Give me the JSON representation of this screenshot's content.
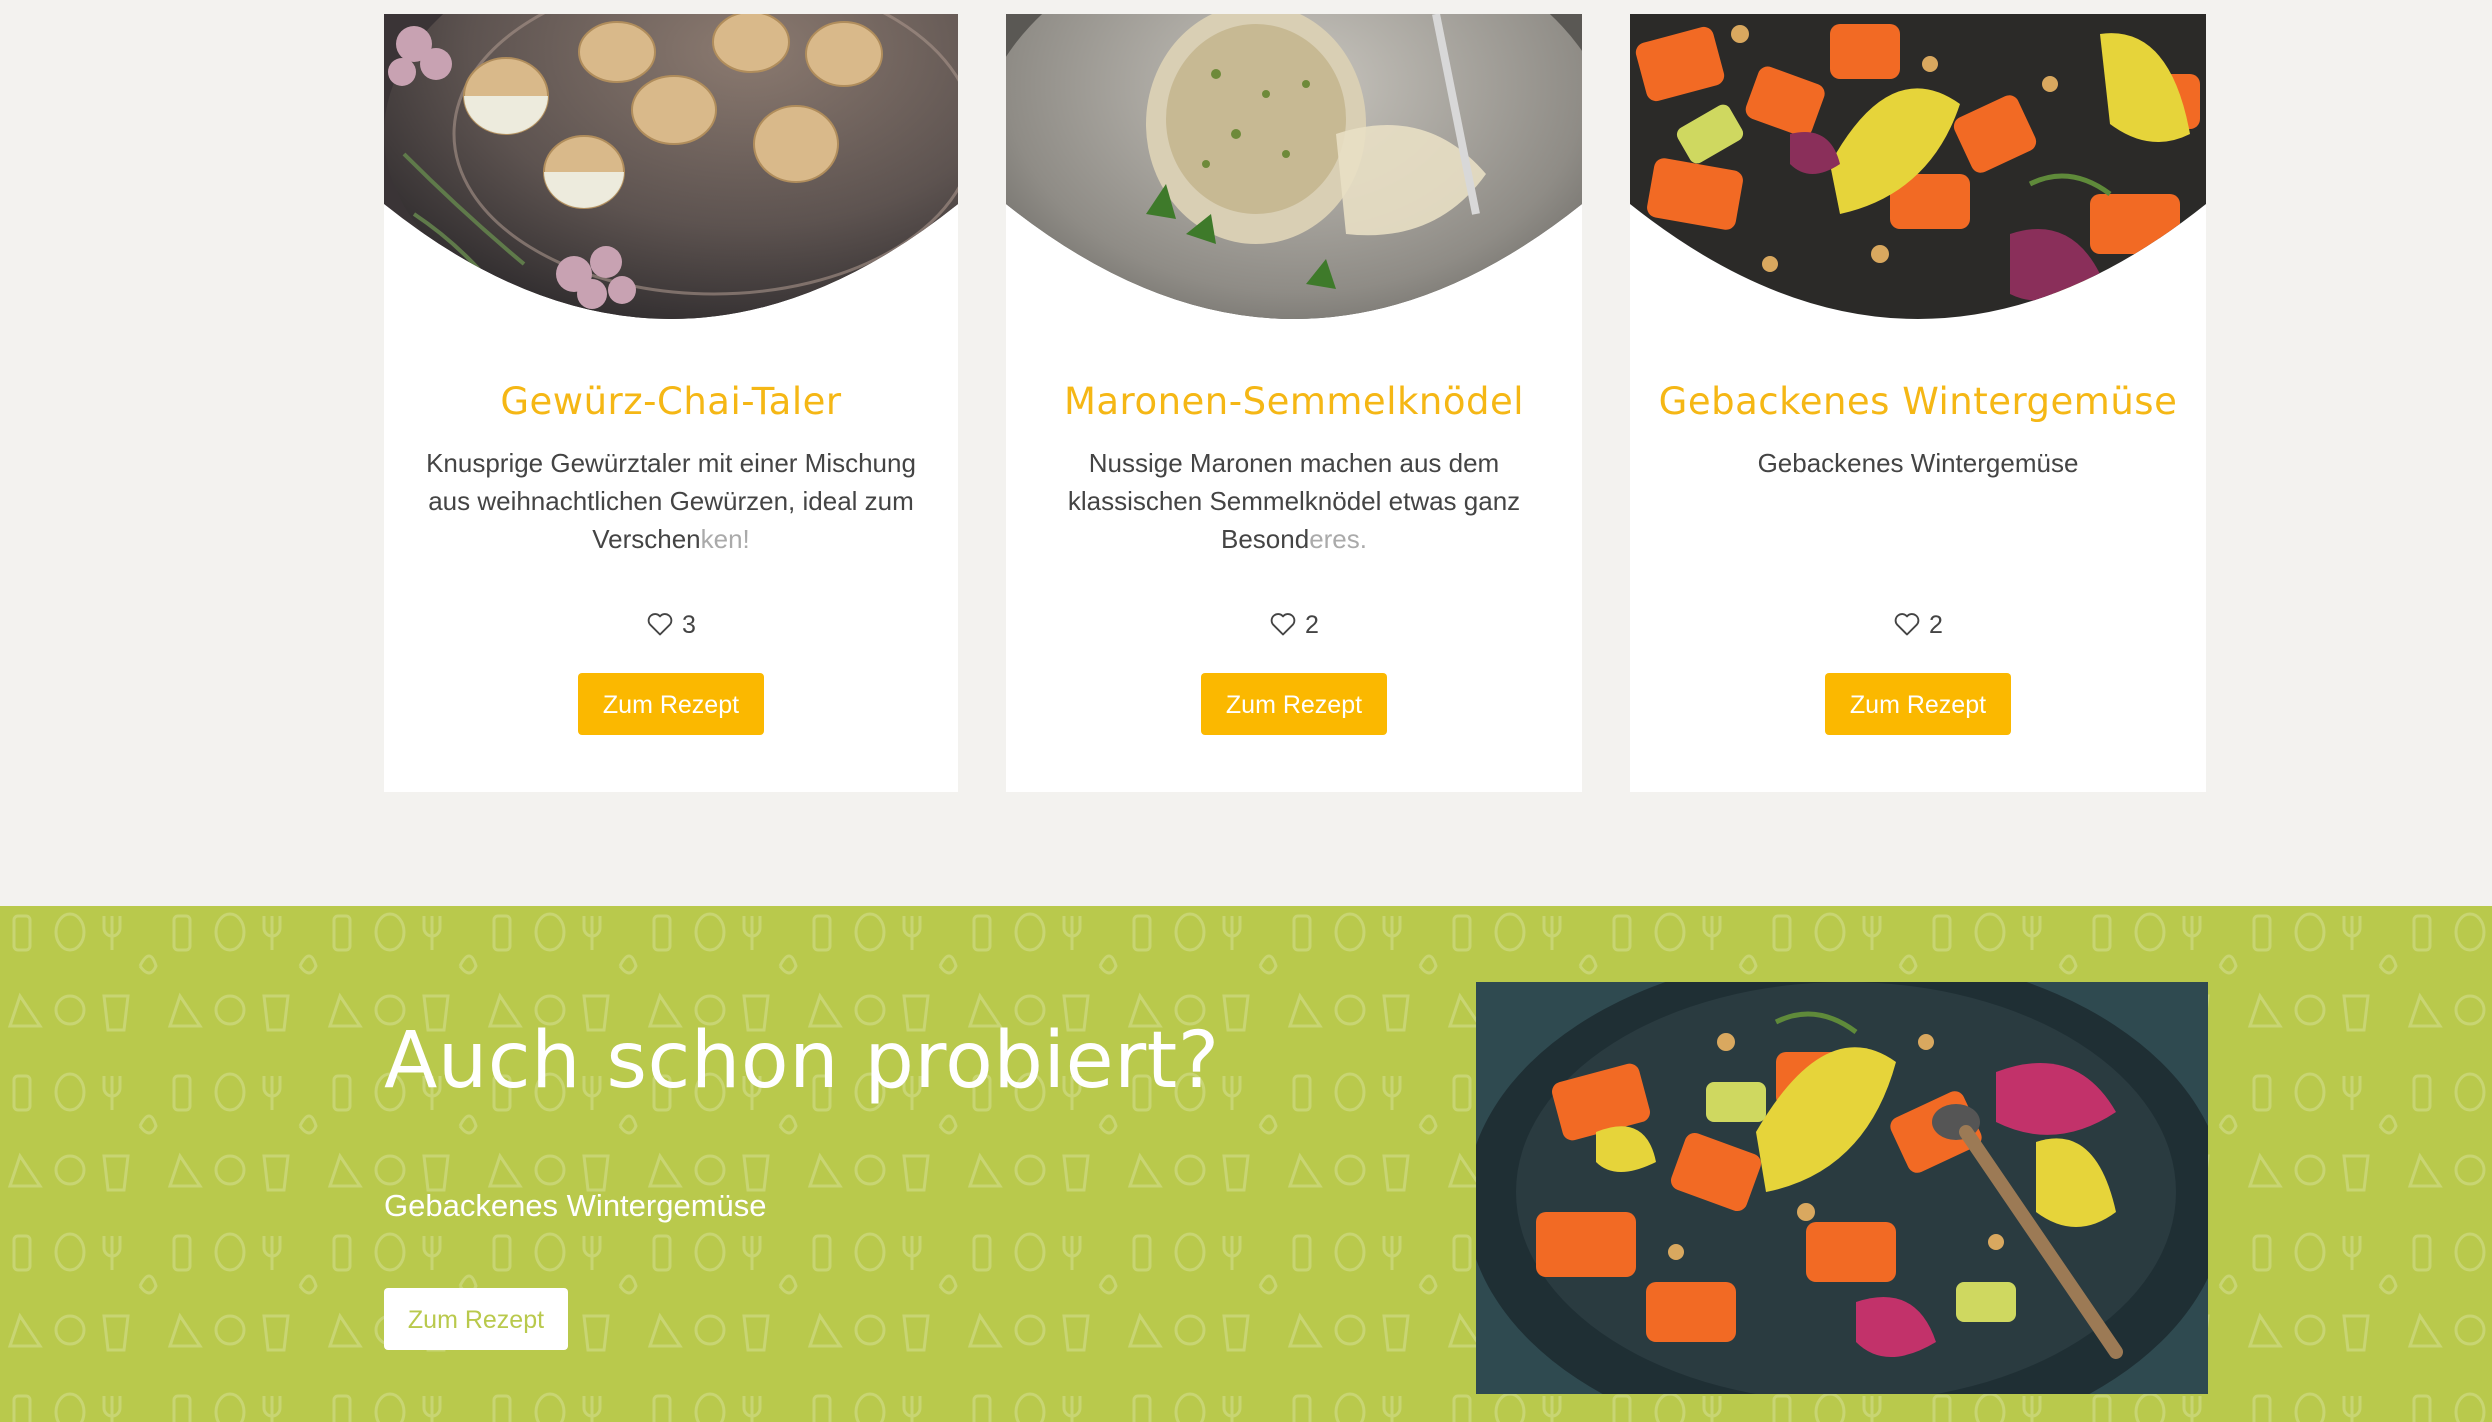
{
  "recipes": [
    {
      "title": "Gewürz-Chai-Taler",
      "description": "Knusprige Gewürztaler mit einer Mischung aus weihnachtlichen Gewürzen, ideal zum Verschen",
      "description_fade": "ken!",
      "likes": "3",
      "button_label": "Zum Rezept"
    },
    {
      "title": "Maronen-Semmelknödel",
      "description": "Nussige Maronen machen aus dem klassischen Semmelknödel etwas ganz Besond",
      "description_fade": "eres.",
      "likes": "2",
      "button_label": "Zum Rezept"
    },
    {
      "title": "Gebackenes Wintergemüse",
      "description": "Gebackenes Wintergemüse",
      "description_fade": "",
      "likes": "2",
      "button_label": "Zum Rezept"
    }
  ],
  "promo": {
    "heading": "Auch schon probiert?",
    "recipe_name": "Gebackenes Wintergemüse",
    "button_label": "Zum Rezept"
  },
  "colors": {
    "accent": "#fbb800",
    "title": "#f5b715",
    "green_band": "#b9c94c",
    "background": "#f3f2ef"
  },
  "icons": {
    "likes": "heart-outline-icon"
  }
}
